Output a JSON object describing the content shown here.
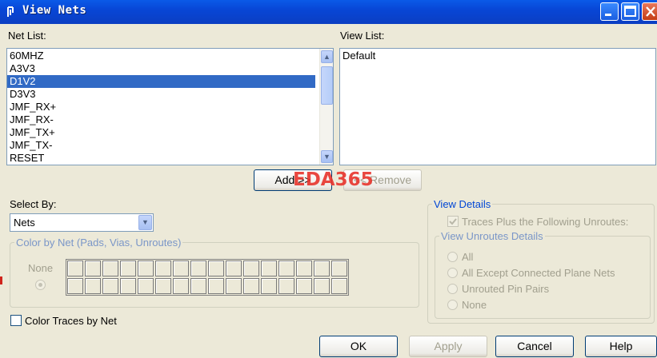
{
  "window": {
    "title": "View Nets",
    "title_icon": "net-icon",
    "controls": [
      "minimize-icon",
      "maximize-icon",
      "close-icon"
    ]
  },
  "net_list": {
    "label": "Net List:",
    "items": [
      "60MHZ",
      "A3V3",
      "D1V2",
      "D3V3",
      "JMF_RX+",
      "JMF_RX-",
      "JMF_TX+",
      "JMF_TX-",
      "RESET"
    ],
    "selected": "D1V2"
  },
  "view_list": {
    "label": "View List:",
    "items": [
      "Default"
    ]
  },
  "buttons": {
    "add": "Add >>",
    "remove": "<< Remove",
    "ok": "OK",
    "apply": "Apply",
    "cancel": "Cancel",
    "help": "Help"
  },
  "select_by": {
    "label": "Select By:",
    "value": "Nets"
  },
  "color_by_net": {
    "title": "Color by Net (Pads, Vias, Unroutes)",
    "none_label": "None"
  },
  "color_traces": {
    "label": "Color Traces by Net",
    "checked": false
  },
  "view_details": {
    "title": "View Details",
    "traces_plus_label": "Traces Plus the Following Unroutes:",
    "traces_plus_checked": true,
    "unroutes_title": "View Unroutes Details",
    "options": [
      "All",
      "All Except Connected Plane Nets",
      "Unrouted Pin Pairs",
      "None"
    ]
  },
  "watermark": "EDA365",
  "colors": {
    "titlebar": "#0846d6",
    "selection": "#316ac5",
    "dialog_bg": "#ece9d8",
    "group_title": "#0046d5"
  }
}
